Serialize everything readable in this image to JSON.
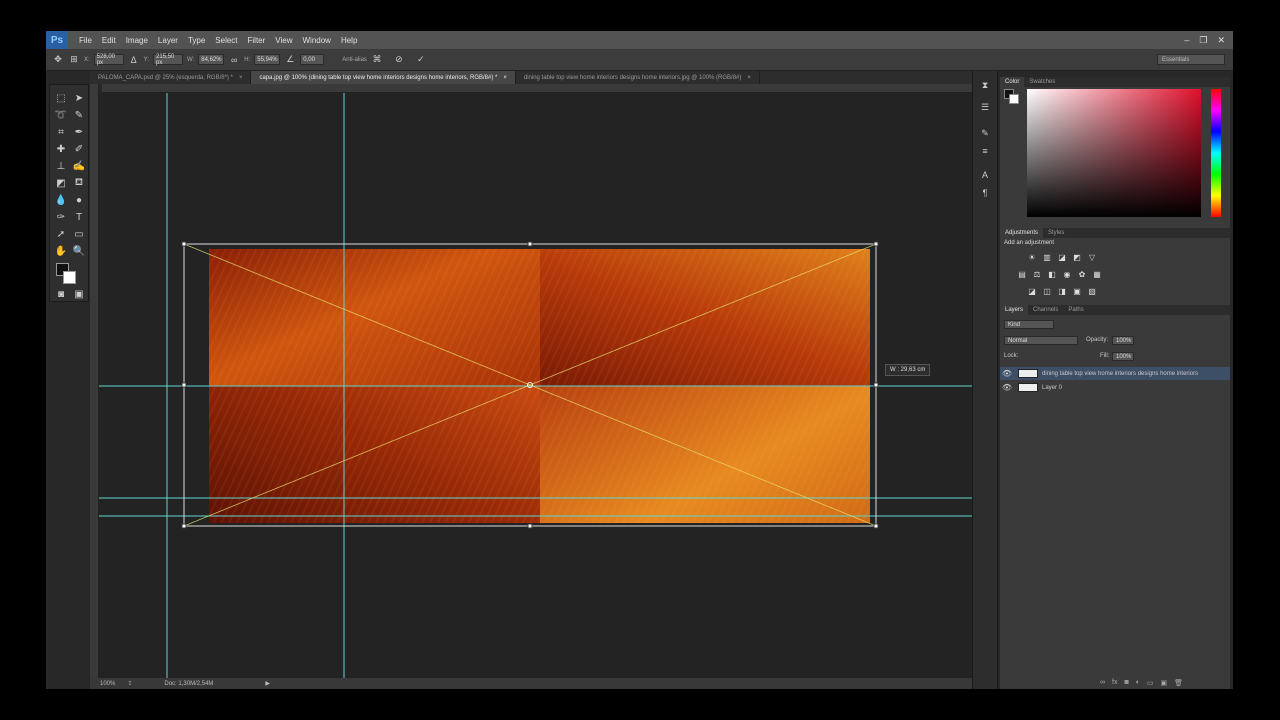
{
  "app": {
    "logo": "Ps"
  },
  "menu": [
    "File",
    "Edit",
    "Image",
    "Layer",
    "Type",
    "Select",
    "Filter",
    "View",
    "Window",
    "Help"
  ],
  "window_controls": [
    "minimize-icon",
    "restore-icon",
    "close-icon"
  ],
  "options": {
    "x_label": "X:",
    "x_value": "528,00 px",
    "y_label": "Y:",
    "y_value": "215,50 px",
    "w_label": "W:",
    "w_value": "84,62%",
    "h_label": "H:",
    "h_value": "55,94%",
    "angle_value": "0,00",
    "interp_label": "Anti-alias",
    "workspace": "Essentials"
  },
  "tabs": [
    {
      "label": "PALOMA_CAPA.psd @ 25% (esquerda, RGB/8*) *",
      "active": false
    },
    {
      "label": "capa.jpg @ 100% (dining table top view home interiors designs home interiors, RGB/8#) *",
      "active": true
    },
    {
      "label": "dining table top view home interiors designs home interiors.jpg @ 100% (RGB/8#)",
      "active": false
    }
  ],
  "tooltip": "W : 29,63 cm",
  "status": {
    "zoom": "100%",
    "doc": "Doc: 1,30M/2,54M"
  },
  "panels": {
    "color_tabs": [
      "Color",
      "Swatches"
    ],
    "adj_tabs": [
      "Adjustments",
      "Styles"
    ],
    "adj_title": "Add an adjustment",
    "layer_tabs": [
      "Layers",
      "Channels",
      "Paths"
    ],
    "kind": "Kind",
    "blend_mode": "Normal",
    "opacity_label": "Opacity:",
    "opacity_value": "100%",
    "lock_label": "Lock:",
    "fill_label": "Fill:",
    "fill_value": "100%",
    "layers": [
      {
        "name": "dining table top view home interiors designs home interiors",
        "selected": true
      },
      {
        "name": "Layer 0",
        "selected": false
      }
    ]
  },
  "colors": {
    "accent_guide": "#5fd6d0",
    "selection_blue": "#3d4f66",
    "image_base": "#b73a0d"
  }
}
